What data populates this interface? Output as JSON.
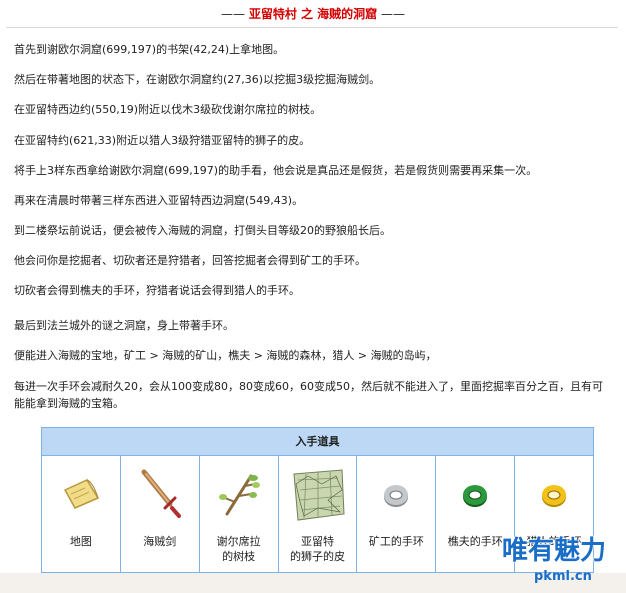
{
  "header": {
    "dash_left": "——",
    "title": "亚留特村 之 海贼的洞窟",
    "dash_right": "——"
  },
  "paragraphs": [
    "首先到谢欧尔洞窟(699,197)的书架(42,24)上拿地图。",
    "然后在带著地图的状态下，在谢欧尔洞窟约(27,36)以挖掘3级挖掘海贼剑。",
    "在亚留特西边约(550,19)附近以伐木3级砍伐谢尔席拉的树枝。",
    "在亚留特约(621,33)附近以猎人3级狩猎亚留特的狮子的皮。",
    "将手上3样东西拿给谢欧尔洞窟(699,197)的助手看，他会说是真品还是假货，若是假货则需要再采集一次。",
    "再来在清晨时带著三样东西进入亚留特西边洞窟(549,43)。",
    "到二楼祭坛前说话，便会被传入海贼的洞窟，打倒头目等级20的野狼船长后。",
    "他会问你是挖掘者、切砍者还是狩猎者，回答挖掘者会得到矿工的手环。",
    "切砍者会得到樵夫的手环，狩猎者说话会得到猎人的手环。",
    "最后到法兰城外的谜之洞窟，身上带著手环。",
    "便能进入海贼的宝地，矿工 > 海贼的矿山，樵夫 > 海贼的森林，猎人 > 海贼的岛屿，",
    "每进一次手环会减耐久20，会从100变成80，80变成60，60变成50，然后就不能进入了，里面挖掘率百分之百，且有可能能拿到海贼的宝箱。"
  ],
  "items_table": {
    "header": "入手道具",
    "items": [
      {
        "label": "地图",
        "icon": "map-scroll-icon"
      },
      {
        "label": "海贼剑",
        "icon": "pirate-sword-icon"
      },
      {
        "label": "谢尔席拉\n的树枝",
        "icon": "tree-branch-icon"
      },
      {
        "label": "亚留特\n的狮子的皮",
        "icon": "lion-pelt-icon"
      },
      {
        "label": "矿工的手环",
        "icon": "gray-bracelet-icon"
      },
      {
        "label": "樵夫的手环",
        "icon": "green-bracelet-icon"
      },
      {
        "label": "猎人的手环",
        "icon": "yellow-bracelet-icon"
      }
    ]
  },
  "colors": {
    "title_red": "#d40000",
    "table_border": "#7fb1e6",
    "table_header_bg": "#bcd8f5"
  },
  "watermark": {
    "logo_text": "唯有魅力",
    "domain": "pkml.cn"
  }
}
